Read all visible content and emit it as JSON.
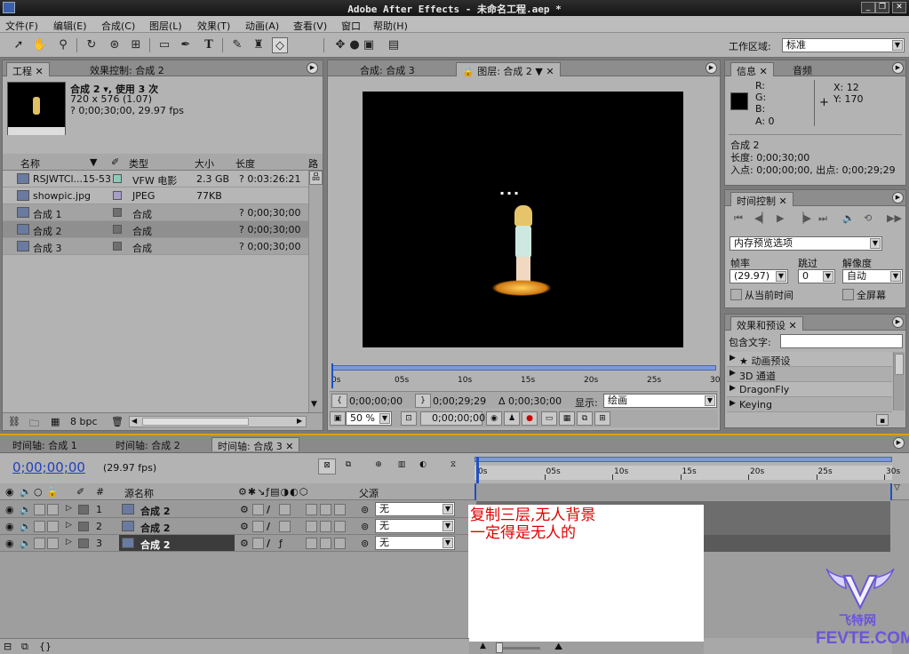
{
  "window": {
    "title": "Adobe After Effects - 未命名工程.aep *"
  },
  "menu": [
    "文件(F)",
    "编辑(E)",
    "合成(C)",
    "图层(L)",
    "效果(T)",
    "动画(A)",
    "查看(V)",
    "窗口",
    "帮助(H)"
  ],
  "toolbar": {
    "workspace_label": "工作区域:",
    "workspace_value": "标准"
  },
  "project": {
    "tabs": [
      "工程",
      "效果控制: 合成 2"
    ],
    "thumb_title": "合成 2 ▾, 使用 3 次",
    "thumb_line2": "720 x 576 (1.07)",
    "thumb_line3": "? 0;00;30;00, 29.97 fps",
    "columns": [
      "名称",
      "类型",
      "大小",
      "长度",
      "路"
    ],
    "rows": [
      {
        "name": "RSJWTCl...15-53",
        "type": "VFW 电影",
        "size": "2.3 GB",
        "length": "? 0:03:26:21",
        "color": "#8fc8b8",
        "icon": "movie-icon"
      },
      {
        "name": "showpic.jpg",
        "type": "JPEG",
        "size": "77KB",
        "length": "",
        "color": "#a89ec6",
        "icon": "image-icon"
      },
      {
        "name": "合成 1",
        "type": "合成",
        "size": "",
        "length": "? 0;00;30;00",
        "color": "#6f6f6f",
        "icon": "comp-icon"
      },
      {
        "name": "合成 2",
        "type": "合成",
        "size": "",
        "length": "? 0;00;30;00",
        "color": "#6f6f6f",
        "icon": "comp-icon"
      },
      {
        "name": "合成 3",
        "type": "合成",
        "size": "",
        "length": "? 0;00;30;00",
        "color": "#6f6f6f",
        "icon": "comp-icon"
      }
    ],
    "bpc": "8 bpc"
  },
  "comp": {
    "tabs": [
      "合成: 合成 3",
      "图层: 合成 2"
    ],
    "ruler": [
      "0s",
      "05s",
      "10s",
      "15s",
      "20s",
      "25s",
      "30"
    ],
    "in_time": "0;00;00;00",
    "out_time": "0;00;29;29",
    "duration": "Δ 0;00;30;00",
    "display_label": "显示:",
    "display_value": "绘画",
    "zoom": "50 %",
    "current_time": "0;00;00;00"
  },
  "info": {
    "tabs": [
      "信息",
      "音频"
    ],
    "r": "R:",
    "g": "G:",
    "b": "B:",
    "a": "A:  0",
    "x": "X:  12",
    "y": "Y:  170",
    "line1": "合成 2",
    "line2": "长度: 0;00;30;00",
    "line3": "入点: 0;00;00;00,  出点: 0;00;29;29"
  },
  "time_control": {
    "tab": "时间控制",
    "preview_option": "内存预览选项",
    "fps_label": "帧率",
    "skip_label": "跳过",
    "res_label": "解像度",
    "fps_value": "(29.97)",
    "skip_value": "0",
    "res_value": "自动",
    "from_current": "从当前时间",
    "fullscreen": "全屏幕"
  },
  "effects": {
    "tab": "效果和预设",
    "contains_label": "包含文字:",
    "items": [
      "★ 动画预设",
      "3D 通道",
      "DragonFly",
      "Keying"
    ]
  },
  "timeline": {
    "tabs": [
      "时间轴: 合成 1",
      "时间轴: 合成 2",
      "时间轴: 合成 3"
    ],
    "timecode": "0;00;00;00",
    "fps": "(29.97 fps)",
    "ruler": [
      "0s",
      "05s",
      "10s",
      "15s",
      "20s",
      "25s",
      "30s"
    ],
    "col_num": "#",
    "col_source": "源名称",
    "col_parent": "父源",
    "layers": [
      {
        "num": "1",
        "name": "合成 2",
        "parent": "无"
      },
      {
        "num": "2",
        "name": "合成 2",
        "parent": "无"
      },
      {
        "num": "3",
        "name": "合成 2",
        "parent": "无"
      }
    ],
    "note_line1": "复制三层,无人背景",
    "note_line2": "一定得是无人的"
  },
  "watermark": {
    "brand_cn": "飞特网",
    "brand_en": "FEVTE.COM"
  }
}
